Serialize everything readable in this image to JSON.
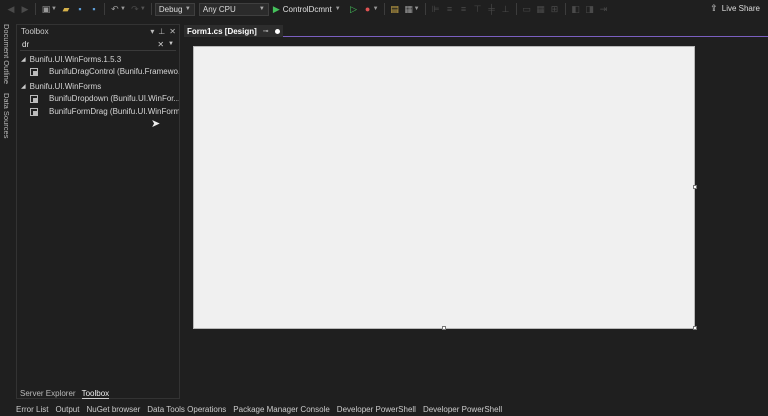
{
  "toolbar": {
    "config": "Debug",
    "platform": "Any CPU",
    "run_target": "ControlDcmnt",
    "icons": [
      "back-icon",
      "forward-icon",
      "new-item-icon",
      "open-icon",
      "save-icon",
      "save-all-icon",
      "undo-icon",
      "redo-icon",
      "run-icon",
      "start-without-debug-icon",
      "hot-reload-icon",
      "browser-icon",
      "deploy-icon"
    ],
    "live_share": "Live Share"
  },
  "left_strip": {
    "tabs": [
      "Document Outline",
      "Data Sources"
    ]
  },
  "toolbox": {
    "title": "Toolbox",
    "search_value": "dr",
    "groups": [
      {
        "name": "Bunifu.UI.WinForms.1.5.3",
        "items": [
          "BunifuDragControl (Bunifu.Framewo..."
        ]
      },
      {
        "name": "Bunifu.UI.WinForms",
        "items": [
          "BunifuDropdown (Bunifu.UI.WinFor...",
          "BunifuFormDrag (Bunifu.UI.WinForms)"
        ]
      }
    ],
    "bottom_tabs": [
      "Server Explorer",
      "Toolbox"
    ]
  },
  "document": {
    "tab_title": "Form1.cs [Design]"
  },
  "bottom_bar": [
    "Error List",
    "Output",
    "NuGet browser",
    "Data Tools Operations",
    "Package Manager Console",
    "Developer PowerShell",
    "Developer PowerShell"
  ],
  "colors": {
    "background": "#1f1f1f",
    "form": "#f0f0f0",
    "accent": "#7a5fc0",
    "run_green": "#45c15b"
  }
}
